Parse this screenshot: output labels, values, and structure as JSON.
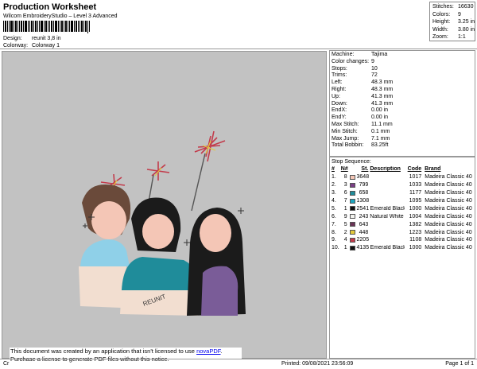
{
  "header": {
    "title": "Production Worksheet",
    "software": "Wilcom EmbroideryStudio – Level 3 Advanced",
    "design_label": "Design:",
    "design_value": "reunit 3,8 in",
    "colorway_label": "Colorway:",
    "colorway_value": "Colorway 1"
  },
  "summary": [
    {
      "label": "Stitches:",
      "value": "16630"
    },
    {
      "label": "Colors:",
      "value": "9"
    },
    {
      "label": "Height:",
      "value": "3.25 in"
    },
    {
      "label": "Width:",
      "value": "3.80 in"
    },
    {
      "label": "Zoom:",
      "value": "1:1"
    }
  ],
  "details": [
    {
      "label": "Machine:",
      "value": "Tajima"
    },
    {
      "label": "Color changes:",
      "value": "9"
    },
    {
      "label": "Stops:",
      "value": "10"
    },
    {
      "label": "Trims:",
      "value": "72"
    },
    {
      "label": "Left:",
      "value": "48.3 mm"
    },
    {
      "label": "Right:",
      "value": "48.3 mm"
    },
    {
      "label": "Up:",
      "value": "41.3 mm"
    },
    {
      "label": "Down:",
      "value": "41.3 mm"
    },
    {
      "label": "EndX:",
      "value": "0.00 in"
    },
    {
      "label": "EndY:",
      "value": "0.00 in"
    },
    {
      "label": "Max Stitch:",
      "value": "11.1 mm"
    },
    {
      "label": "Min Stitch:",
      "value": "0.1 mm"
    },
    {
      "label": "Max Jump:",
      "value": "7.1 mm"
    },
    {
      "label": "Total Bobbin:",
      "value": "83.25ft"
    }
  ],
  "stops": {
    "caption": "Stop Sequence:",
    "headers": {
      "num": "#",
      "n": "N#",
      "st": "St.",
      "desc": "Description",
      "code": "Code",
      "brand": "Brand"
    },
    "rows": [
      {
        "num": "1.",
        "n": "8",
        "color": "#f4c6b6",
        "st": "3648",
        "desc": "",
        "code": "1017",
        "brand": "Madeira Classic 40"
      },
      {
        "num": "2.",
        "n": "3",
        "color": "#7a3f86",
        "st": "799",
        "desc": "",
        "code": "1033",
        "brand": "Madeira Classic 40"
      },
      {
        "num": "3.",
        "n": "6",
        "color": "#1f8c9a",
        "st": "658",
        "desc": "",
        "code": "1177",
        "brand": "Madeira Classic 40"
      },
      {
        "num": "4.",
        "n": "7",
        "color": "#1da7c0",
        "st": "1308",
        "desc": "",
        "code": "1095",
        "brand": "Madeira Classic 40"
      },
      {
        "num": "5.",
        "n": "1",
        "color": "#111111",
        "st": "2541",
        "desc": "Emerald Black",
        "code": "1000",
        "brand": "Madeira Classic 40"
      },
      {
        "num": "6.",
        "n": "9",
        "color": "#f2f2ee",
        "st": "243",
        "desc": "Natural White",
        "code": "1004",
        "brand": "Madeira Classic 40"
      },
      {
        "num": "7.",
        "n": "5",
        "color": "#6a3356",
        "st": "643",
        "desc": "",
        "code": "1382",
        "brand": "Madeira Classic 40"
      },
      {
        "num": "8.",
        "n": "2",
        "color": "#e2c93b",
        "st": "448",
        "desc": "",
        "code": "1223",
        "brand": "Madeira Classic 40"
      },
      {
        "num": "9.",
        "n": "4",
        "color": "#c23b4b",
        "st": "2205",
        "desc": "",
        "code": "1108",
        "brand": "Madeira Classic 40"
      },
      {
        "num": "10.",
        "n": "1",
        "color": "#111111",
        "st": "4135",
        "desc": "Emerald Black",
        "code": "1000",
        "brand": "Madeira Classic 40"
      }
    ]
  },
  "design": {
    "stitched_text": "REUNIT"
  },
  "notice": {
    "line1": "This document was created by an application that isn't licensed to use ",
    "link": "novaPDF",
    "line1_end": ".",
    "line2": "Purchase a license to generate PDF files without this notice."
  },
  "footer": {
    "left": "Cr",
    "printed": "Printed: 09/08/2021 23:56:09",
    "page": "Page 1 of 1"
  }
}
